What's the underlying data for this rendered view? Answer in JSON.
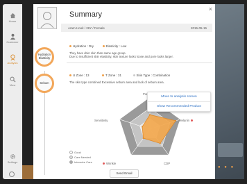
{
  "sidebar": {
    "items": [
      {
        "label": "Home",
        "icon": "house-icon"
      },
      {
        "label": "Customer",
        "icon": "person-icon"
      },
      {
        "label": "Analysis",
        "icon": "face-icon",
        "active": true
      },
      {
        "label": "View",
        "icon": "magnifier-icon"
      },
      {
        "label": "Settings",
        "icon": "gear-icon"
      }
    ]
  },
  "dialog": {
    "title": "Summary",
    "customer": "Aram Hook / 26Y / Female",
    "date": "2015-05-15",
    "close_glyph": "×",
    "rings": {
      "hydration": "Hydration Elasticity",
      "sebum": "Sebum"
    },
    "hydration_row": {
      "hydration": "Hydration : Dry",
      "elasticity": "Elasticity : Low"
    },
    "hydration_desc": "They have drier skin than same age group.\nDue to insufficient skin elasticity, skin texture looks loose and pore looks larger.",
    "sebum_row": {
      "u_zone": "U Zone : 13",
      "t_zone": "T Zone : 31",
      "skin_type": "Skin Type : Combination"
    },
    "sebum_desc": "The skin type combined Excessive sebum area and lack of sebum area.",
    "radar": {
      "labels": {
        "top": "Pore",
        "right": "Melanin",
        "bottom_right": "CDP",
        "bottom_left": "Wrinkle",
        "left": "Sensitivity"
      },
      "values": [
        0.45,
        0.85,
        0.55,
        0.35,
        0.25
      ]
    },
    "legend": [
      "Good",
      "Care Needed",
      "Intensive Care"
    ],
    "send_email": "Send Email",
    "popup": {
      "analysis": "Move to analysis screen",
      "recommended": "Show Recommended Product"
    }
  },
  "colors": {
    "accent": "#f0a14b",
    "link": "#2b6fc4",
    "ring": "#f2a75a",
    "radar_fill": "#f3a64a"
  }
}
